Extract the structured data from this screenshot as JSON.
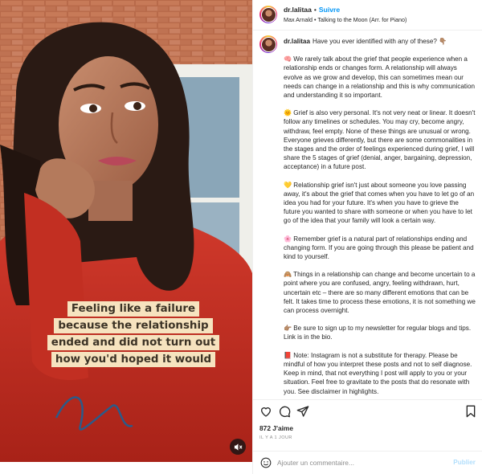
{
  "overlay": {
    "lines": [
      "Feeling like a failure",
      "because the relationship",
      "ended and did not turn out",
      "how you'd hoped it would"
    ],
    "mute_icon": "speaker-muted-icon"
  },
  "header": {
    "username": "dr.lalitaa",
    "separator": "•",
    "follow_label": "Suivre",
    "audio": "Max Arnald • Talking to the Moon (Arr. for Piano)"
  },
  "caption": {
    "username": "dr.lalitaa",
    "intro": "Have you ever identified with any of these? 👇🏽",
    "paragraphs": [
      {
        "emoji": "🧠",
        "text": "We rarely talk about the grief that people experience when a relationship ends or changes form. A relationship will always evolve as we grow and develop, this can sometimes mean our needs can change in a relationship and this is why communication and understanding it so important."
      },
      {
        "emoji": "🌞",
        "text": "Grief is also very personal. It's not very neat or linear. It doesn't follow any timelines or schedules. You may cry, become angry, withdraw, feel empty. None of these things are unusual or wrong. Everyone grieves differently, but there are some commonalities in the stages and the order of feelings experienced during grief, I will share the 5 stages of grief (denial, anger, bargaining, depression, acceptance) in a future post."
      },
      {
        "emoji": "💛",
        "text": "Relationship grief isn't just about someone you love passing away, it's about the grief that comes when you have to let go of an idea you had for your future. It's when you have to grieve the future you wanted to share with someone or when you have to let go of the idea that your family will look a certain way."
      },
      {
        "emoji": "🌸",
        "text": "Remember grief is a natural part of relationships ending and changing form. If you are going through this please be patient and kind to yourself."
      },
      {
        "emoji": "🙈",
        "text": "Things in a relationship can change and become uncertain to a point where you are confused, angry, feeling withdrawn, hurt, uncertain etc – there are so many different emotions that can be felt. It takes time to process these emotions, it is not something we can process overnight."
      },
      {
        "emoji": "👉🏽",
        "text": "Be sure to sign up to my newsletter for regular blogs and tips. Link is in the bio."
      },
      {
        "emoji": "📕",
        "text": "Note: Instagram is not a substitute for therapy. Please be mindful of how you interpret these posts and not to self diagnose. Keep in mind, that not everything I post will apply to you or your situation. Feel free to gravitate to the posts that do resonate with you. See disclaimer in highlights."
      }
    ]
  },
  "actions": {
    "like_icon": "heart-icon",
    "comment_icon": "comment-bubble-icon",
    "share_icon": "paper-plane-icon",
    "save_icon": "bookmark-icon"
  },
  "stats": {
    "likes": "872 J'aime",
    "time_ago": "IL Y A 1 JOUR"
  },
  "comment": {
    "emoji_icon": "smiley-icon",
    "placeholder": "Ajouter un commentaire...",
    "publish_label": "Publier"
  },
  "colors": {
    "accent": "#0095f6",
    "publish_disabled": "#b2dffc",
    "overlay_bg": "#f6e3bf",
    "sweater": "#c92f22"
  }
}
